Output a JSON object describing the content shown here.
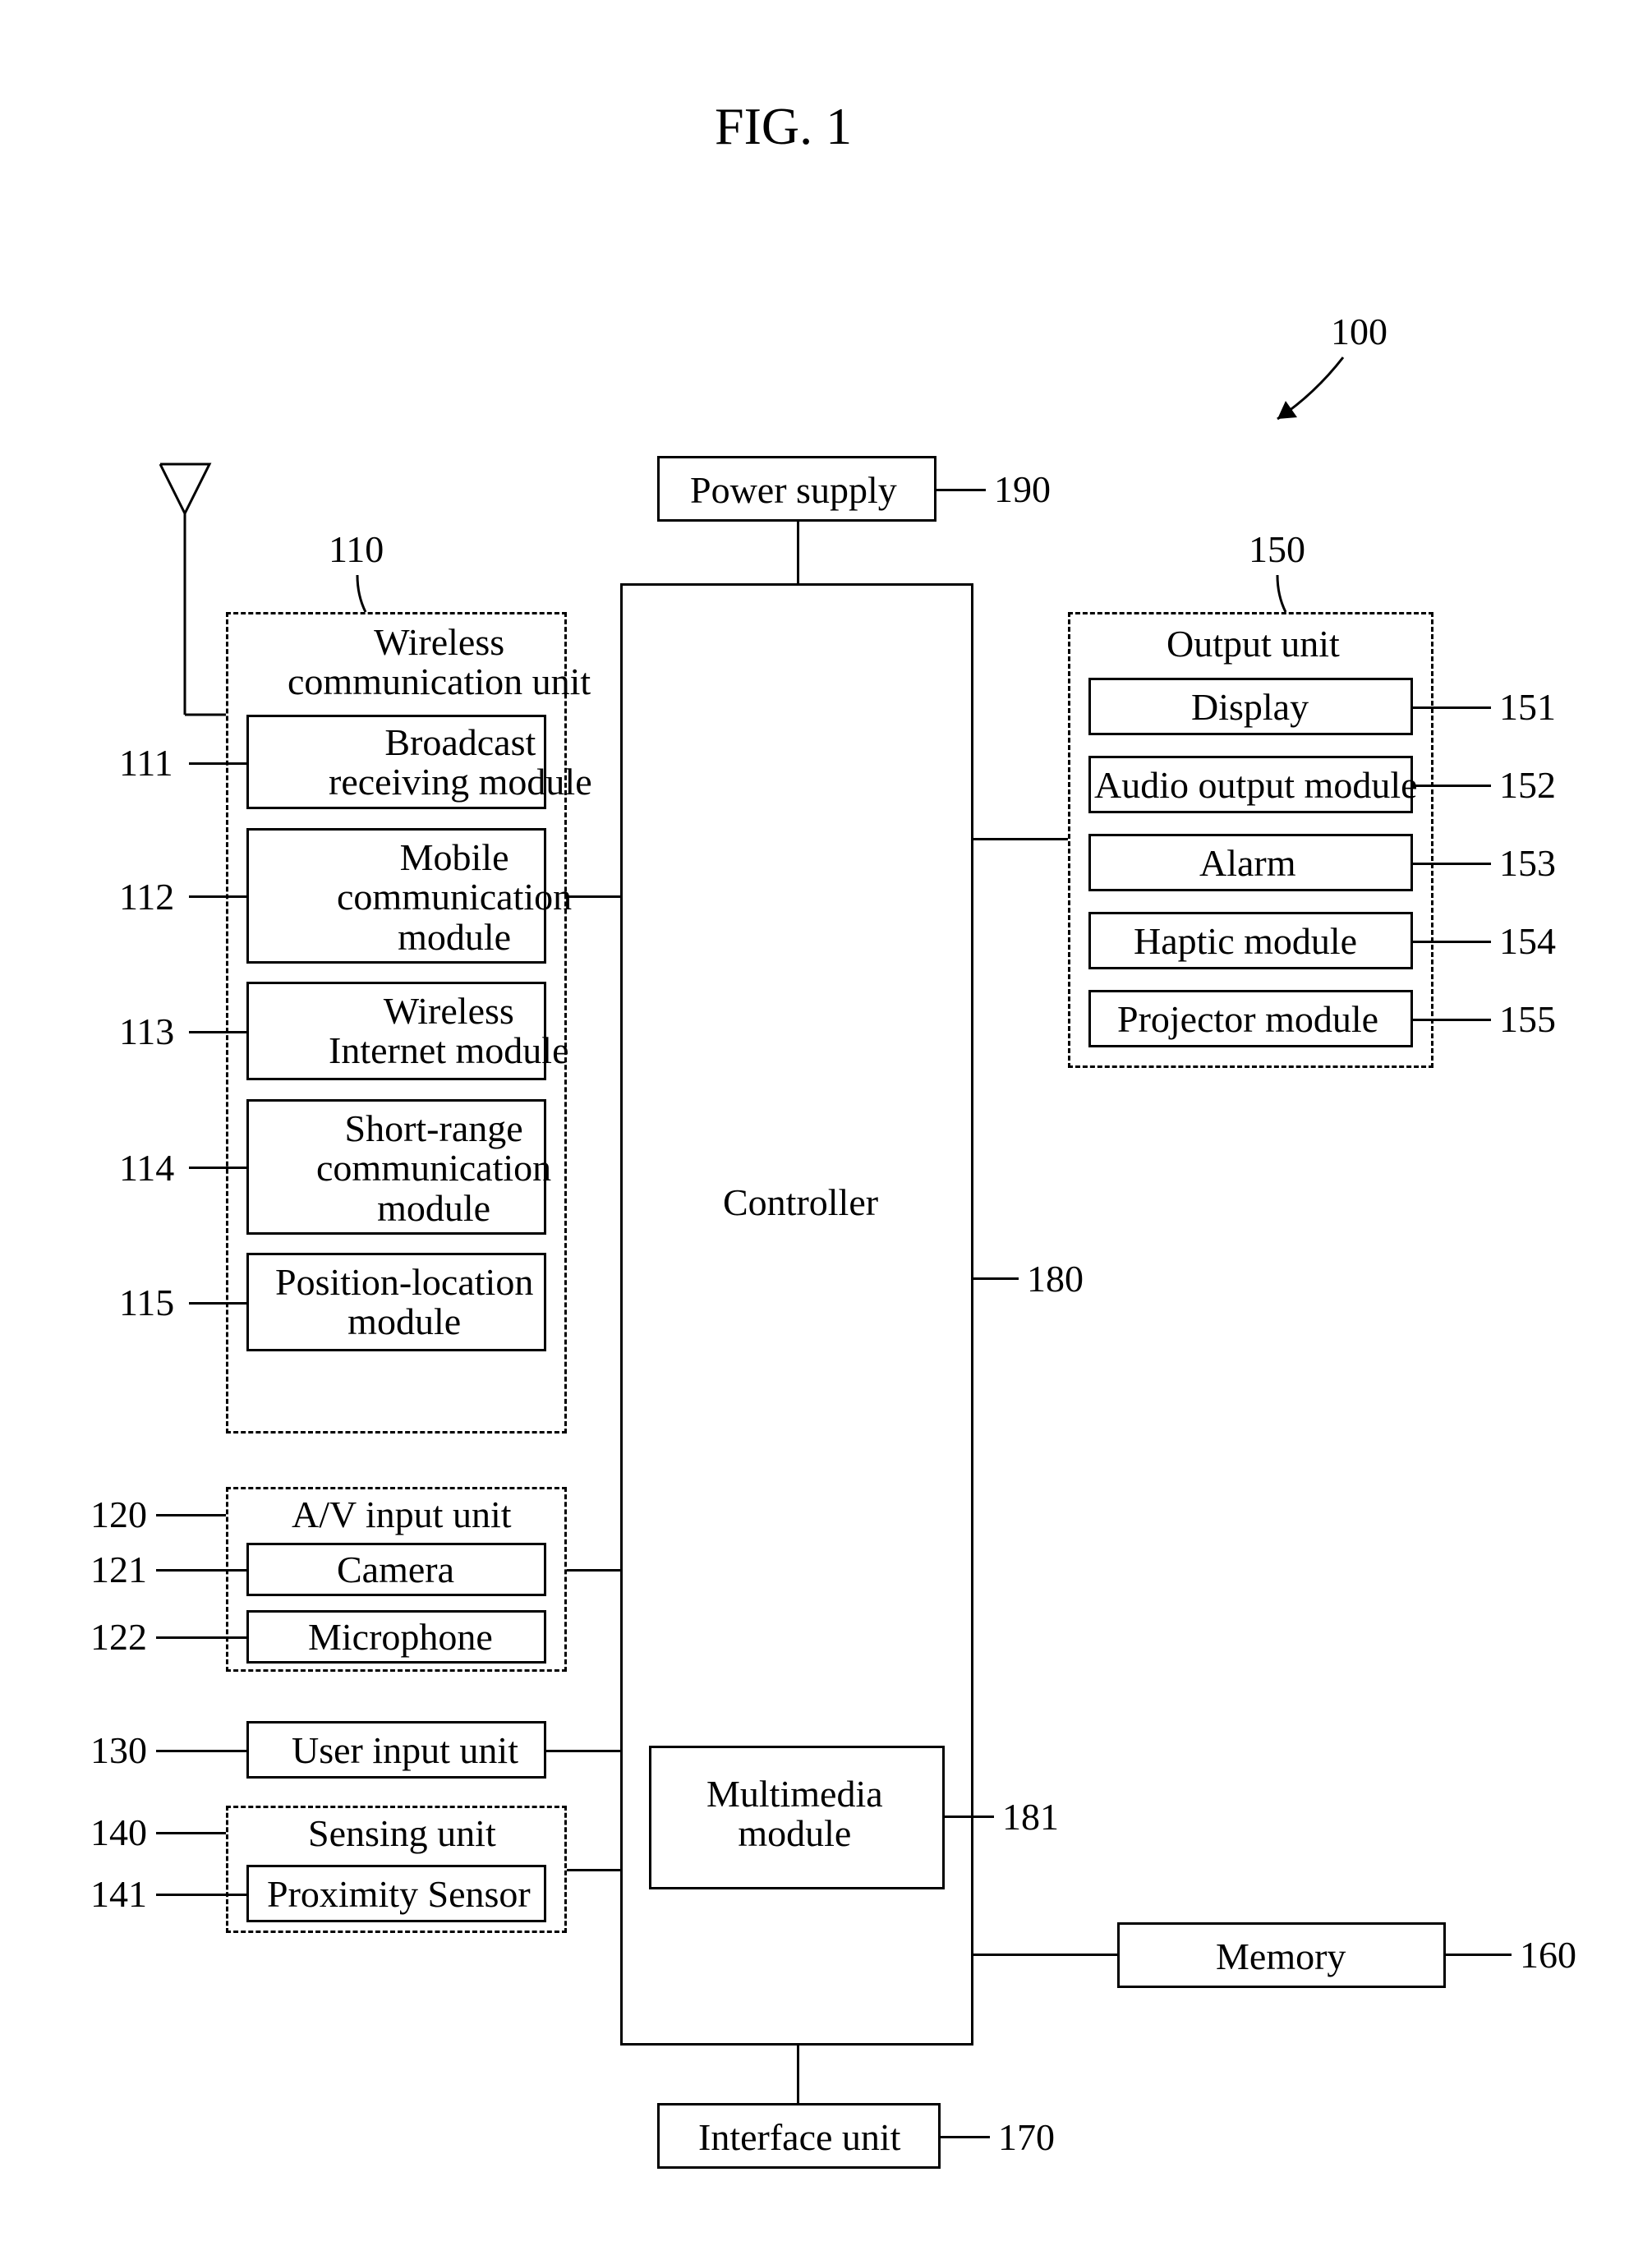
{
  "fig_title": "FIG. 1",
  "ref_100": "100",
  "ref_110": "110",
  "ref_111": "111",
  "ref_112": "112",
  "ref_113": "113",
  "ref_114": "114",
  "ref_115": "115",
  "ref_120": "120",
  "ref_121": "121",
  "ref_122": "122",
  "ref_130": "130",
  "ref_140": "140",
  "ref_141": "141",
  "ref_150": "150",
  "ref_151": "151",
  "ref_152": "152",
  "ref_153": "153",
  "ref_154": "154",
  "ref_155": "155",
  "ref_160": "160",
  "ref_170": "170",
  "ref_180": "180",
  "ref_181": "181",
  "ref_190": "190",
  "power_supply": "Power supply",
  "controller": "Controller",
  "multimedia_module": "Multimedia\nmodule",
  "interface_unit": "Interface unit",
  "memory": "Memory",
  "wireless_unit_title": "Wireless\ncommunication unit",
  "broadcast": "Broadcast\nreceiving module",
  "mobile_comm": "Mobile\ncommunication\nmodule",
  "wireless_internet": "Wireless\nInternet module",
  "short_range": "Short-range\ncommunication\nmodule",
  "position_location": "Position-location\nmodule",
  "av_input_title": "A/V input unit",
  "camera": "Camera",
  "microphone": "Microphone",
  "user_input": "User input unit",
  "sensing_unit_title": "Sensing unit",
  "proximity_sensor": "Proximity Sensor",
  "output_unit_title": "Output unit",
  "display": "Display",
  "audio_output": "Audio output module",
  "alarm": "Alarm",
  "haptic": "Haptic module",
  "projector": "Projector module"
}
